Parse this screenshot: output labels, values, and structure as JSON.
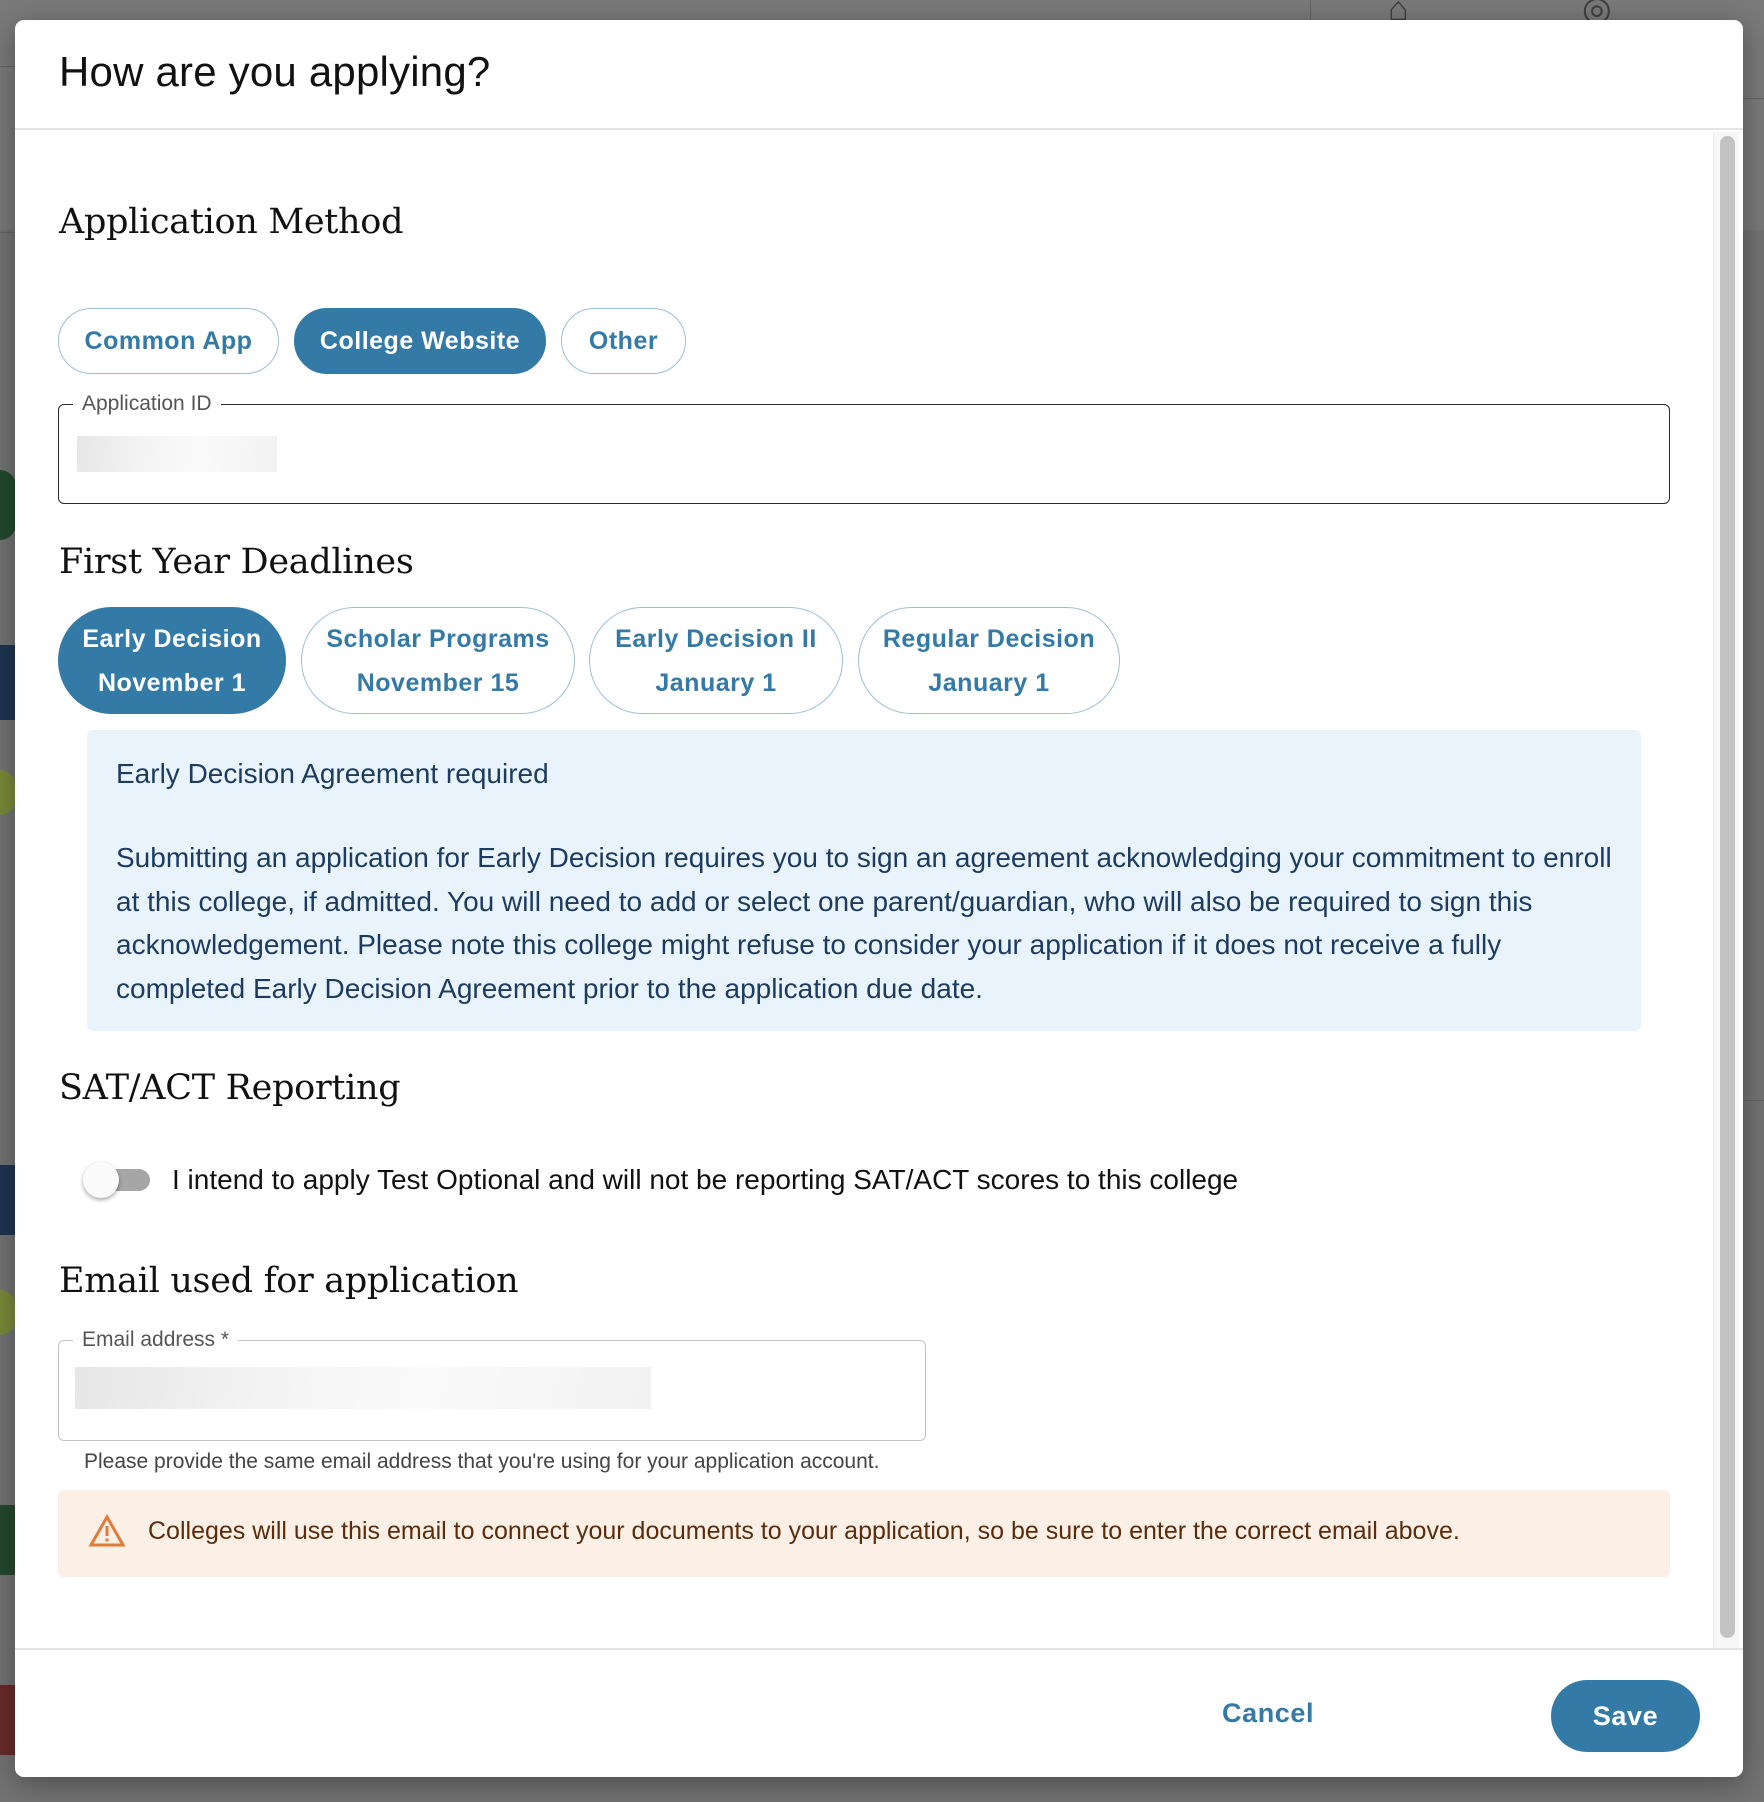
{
  "modal": {
    "title": "How are you applying?"
  },
  "application_method": {
    "heading": "Application Method",
    "options": [
      {
        "label": "Common App",
        "selected": false
      },
      {
        "label": "College Website",
        "selected": true
      },
      {
        "label": "Other",
        "selected": false
      }
    ],
    "application_id": {
      "label": "Application ID",
      "value": "[redacted]"
    }
  },
  "deadlines": {
    "heading": "First Year Deadlines",
    "options": [
      {
        "name": "Early Decision",
        "date": "November 1",
        "selected": true
      },
      {
        "name": "Scholar Programs",
        "date": "November 15",
        "selected": false
      },
      {
        "name": "Early Decision II",
        "date": "January 1",
        "selected": false
      },
      {
        "name": "Regular Decision",
        "date": "January 1",
        "selected": false
      }
    ],
    "info": {
      "title": "Early Decision Agreement required",
      "text": "Submitting an application for Early Decision requires you to sign an agreement acknowledging your commitment to enroll at this college, if admitted. You will need to add or select one parent/guardian, who will also be required to sign this acknowledgement. Please note this college might refuse to consider your application if it does not receive a fully completed Early Decision Agreement prior to the application due date."
    }
  },
  "sat_act": {
    "heading": "SAT/ACT Reporting",
    "toggle_label": "I intend to apply Test Optional and will not be reporting SAT/ACT scores to this college",
    "toggle_on": false
  },
  "email": {
    "heading": "Email used for application",
    "field_label": "Email address *",
    "value": "[redacted]",
    "helper": "Please provide the same email address that you're using for your application account.",
    "warning_icon": "warning-triangle-icon",
    "warning": "Colleges will use this email to connect your documents to your application, so be sure to enter the correct email above."
  },
  "footer": {
    "cancel_label": "Cancel",
    "save_label": "Save"
  },
  "colors": {
    "primary": "#347aa6",
    "info_bg": "#e8f3fc",
    "info_text": "#1d3b5e",
    "warning_bg": "#fbefe6",
    "warning_text": "#5a2d0c",
    "warning_icon": "#e07b3c"
  }
}
